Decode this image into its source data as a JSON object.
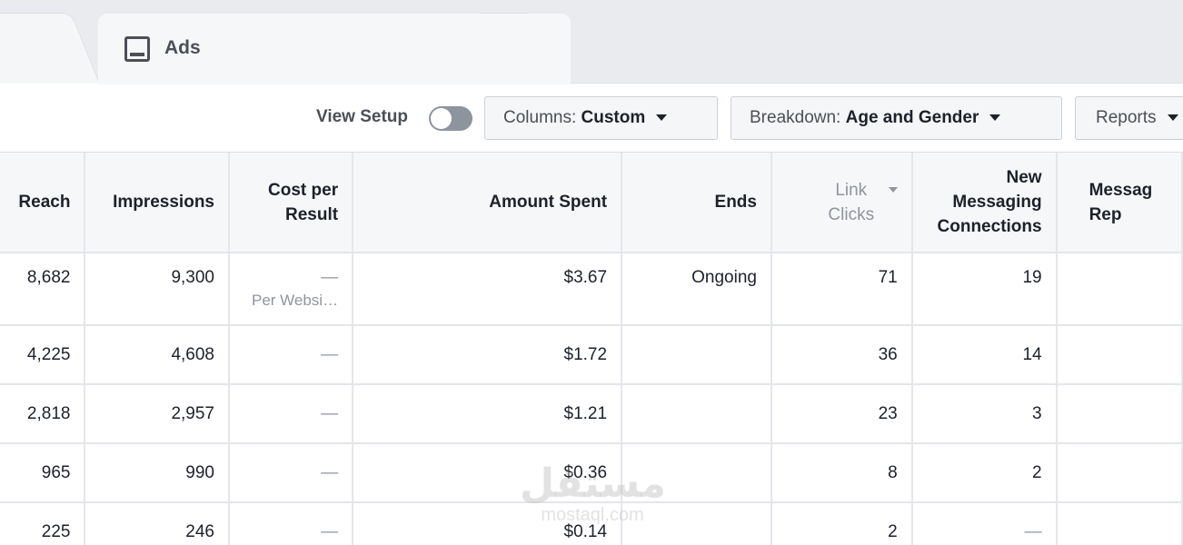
{
  "tabs": {
    "active_label": "Ads",
    "active_icon": "ad-monitor-icon"
  },
  "toolbar": {
    "view_setup_label": "View Setup",
    "view_setup_on": false,
    "columns_prefix": "Columns: ",
    "columns_value": "Custom",
    "breakdown_prefix": "Breakdown: ",
    "breakdown_value": "Age and Gender",
    "reports_label": "Reports"
  },
  "table": {
    "headers": {
      "reach": "Reach",
      "impressions": "Impressions",
      "cost_per_result": "Cost per Result",
      "amount_spent": "Amount Spent",
      "ends": "Ends",
      "link_clicks": "Link Clicks",
      "new_messaging": "New Messaging Connections",
      "messaging_rep": "Messag Rep"
    },
    "rows": [
      {
        "reach": "8,682",
        "impressions": "9,300",
        "cost": "—",
        "cost_sub": "Per Websi…",
        "amount": "$3.67",
        "ends": "Ongoing",
        "link_clicks": "71",
        "new_messaging": "19"
      },
      {
        "reach": "4,225",
        "impressions": "4,608",
        "cost": "—",
        "cost_sub": "",
        "amount": "$1.72",
        "ends": "",
        "link_clicks": "36",
        "new_messaging": "14"
      },
      {
        "reach": "2,818",
        "impressions": "2,957",
        "cost": "—",
        "cost_sub": "",
        "amount": "$1.21",
        "ends": "",
        "link_clicks": "23",
        "new_messaging": "3"
      },
      {
        "reach": "965",
        "impressions": "990",
        "cost": "—",
        "cost_sub": "",
        "amount": "$0.36",
        "ends": "",
        "link_clicks": "8",
        "new_messaging": "2"
      },
      {
        "reach": "225",
        "impressions": "246",
        "cost": "—",
        "cost_sub": "",
        "amount": "$0.14",
        "ends": "",
        "link_clicks": "2",
        "new_messaging": "—"
      }
    ]
  },
  "watermark": {
    "arabic": "مستقل",
    "latin": "mostaql.com"
  }
}
